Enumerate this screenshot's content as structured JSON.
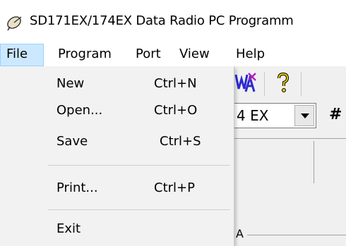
{
  "window": {
    "title": "SD171EX/174EX Data Radio PC Programm",
    "icon": "satellite-dish-icon"
  },
  "menubar": {
    "items": [
      {
        "label": "File"
      },
      {
        "label": "Program"
      },
      {
        "label": "Port"
      },
      {
        "label": "View"
      },
      {
        "label": "Help"
      }
    ]
  },
  "toolbar": {
    "buttons": [
      {
        "icon": "write-radio-icon"
      },
      {
        "icon": "help-question-icon"
      }
    ]
  },
  "model_select": {
    "value": "4 EX"
  },
  "background_text": {
    "hash": "#",
    "partial_label": "A"
  },
  "file_menu": {
    "items": [
      {
        "label": "New",
        "shortcut": "Ctrl+N"
      },
      {
        "label": "Open...",
        "shortcut": "Ctrl+O"
      },
      {
        "label": "Save",
        "shortcut": "Ctrl+S"
      },
      {
        "label": "Print...",
        "shortcut": "Ctrl+P"
      },
      {
        "label": "Exit",
        "shortcut": ""
      }
    ]
  },
  "colors": {
    "menu_highlight": "#cce8ff",
    "menu_background": "#f2f2f2",
    "toolbar_icon_blue": "#2a2ad0",
    "toolbar_icon_purple": "#b020c0",
    "help_icon_yellow": "#e8c800"
  }
}
